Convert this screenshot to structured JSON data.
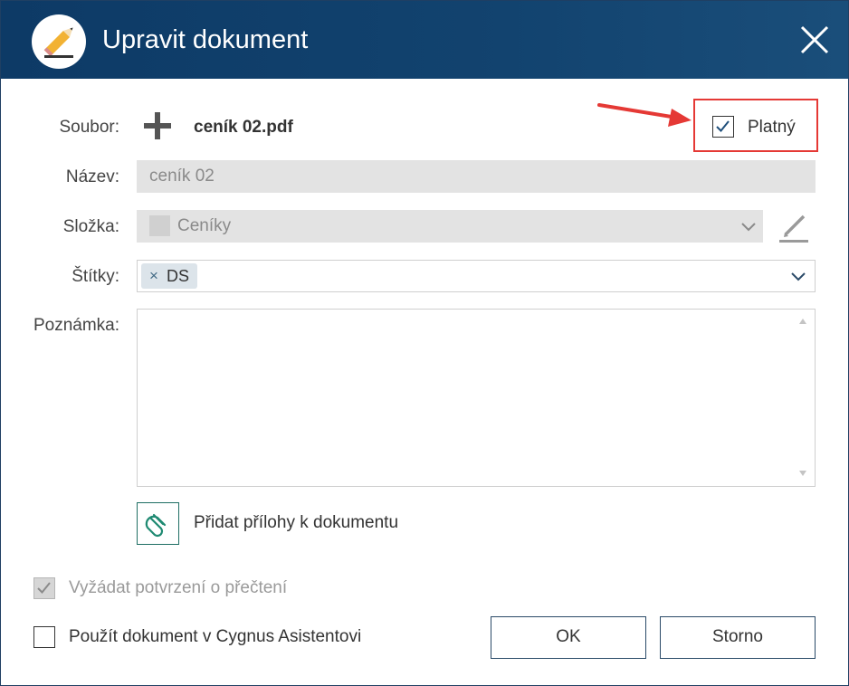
{
  "window": {
    "title": "Upravit dokument",
    "app_icon": "pencil-icon",
    "close_icon": "close-icon",
    "titlebar_color": "#0d3a66"
  },
  "file": {
    "label": "Soubor:",
    "add_icon": "plus-icon",
    "filename": "ceník 02.pdf"
  },
  "valid": {
    "label": "Platný",
    "checked": true,
    "highlight_color": "#e53935"
  },
  "name": {
    "label": "Název:",
    "value": "ceník 02",
    "disabled": true
  },
  "folder": {
    "label": "Složka:",
    "value": "Ceníky",
    "disabled": true,
    "edit_icon": "edit-pencil-icon"
  },
  "tags": {
    "label": "Štítky:",
    "items": [
      {
        "remove": "×",
        "text": "DS"
      }
    ]
  },
  "note": {
    "label": "Poznámka:",
    "value": ""
  },
  "attachments": {
    "icon": "paperclip-icon",
    "label": "Přidat přílohy k dokumentu",
    "accent_color": "#1f6f64"
  },
  "options": {
    "read_confirm": {
      "label": "Vyžádat potvrzení o přečtení",
      "checked": true,
      "disabled": true
    },
    "cygnus": {
      "label": "Použít dokument v Cygnus Asistentovi",
      "checked": false
    }
  },
  "buttons": {
    "ok": "OK",
    "cancel": "Storno"
  }
}
